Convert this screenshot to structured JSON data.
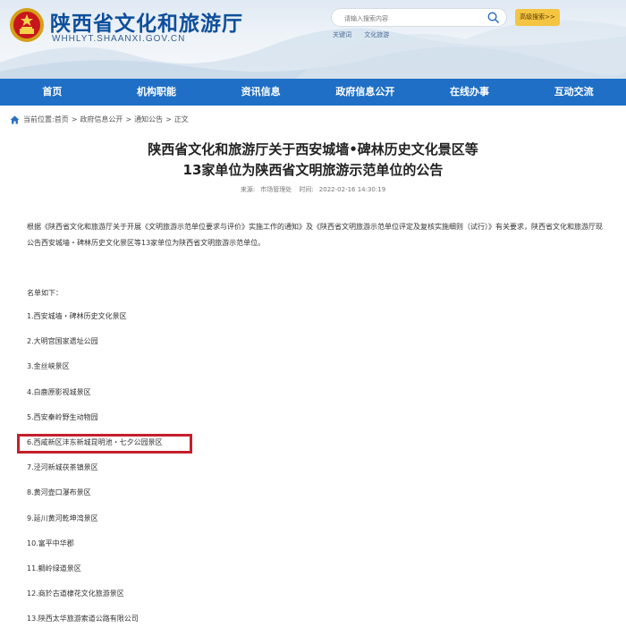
{
  "header": {
    "site_title": "陕西省文化和旅游厅",
    "site_domain": "WHHLYT.SHAANXI.GOV.CN",
    "search_placeholder": "请输入搜索内容",
    "advanced_search": "高级搜索>>",
    "hot_words": [
      "关键词",
      "文化旅游"
    ]
  },
  "nav": {
    "items": [
      "首页",
      "机构职能",
      "资讯信息",
      "政府信息公开",
      "在线办事",
      "互动交流"
    ]
  },
  "breadcrumb": {
    "prefix": "当前位置:",
    "items": [
      "首页",
      "政府信息公开",
      "通知公告",
      "正文"
    ],
    "separator": ">"
  },
  "article": {
    "title_line1": "陕西省文化和旅游厅关于西安城墙•碑林历史文化景区等",
    "title_line2": "13家单位为陕西省文明旅游示范单位的公告",
    "source_label": "来源:",
    "source": "市场管理处",
    "time_label": "时间:",
    "time": "2022-02-16 14:30:19",
    "paragraph": "根据《陕西省文化和旅游厅关于开展《文明旅游示范单位要求与评价》实施工作的通知》及《陕西省文明旅游示范单位评定及复核实施细则（试行）》有关要求，陕西省文化和旅游厅现公告西安城墙・碑林历史文化景区等13家单位为陕西省文明旅游示范单位。",
    "list_intro": "名单如下：",
    "list": [
      "1.西安城墙・碑林历史文化景区",
      "2.大明宫国家遗址公园",
      "3.金丝峡景区",
      "4.白鹿原影视城景区",
      "5.西安秦岭野生动物园",
      "6.西咸新区沣东新城昆明池・七夕公园景区",
      "7.泾河新城茯茶镇景区",
      "8.黄河壶口瀑布景区",
      "9.延川黄河乾坤湾景区",
      "10.富平中华郡",
      "11.鲷岭绿道景区",
      "12.商於古道棣花文化旅游景区",
      "13.陕西太华旅游索道公路有限公司"
    ]
  },
  "colors": {
    "nav_bg": "#1e6fc5",
    "title_blue": "#0e4f9c",
    "highlight_red": "#c4202a",
    "adv_btn": "#f4c542"
  },
  "icons": [
    "national-emblem-icon",
    "search-icon",
    "home-icon"
  ]
}
